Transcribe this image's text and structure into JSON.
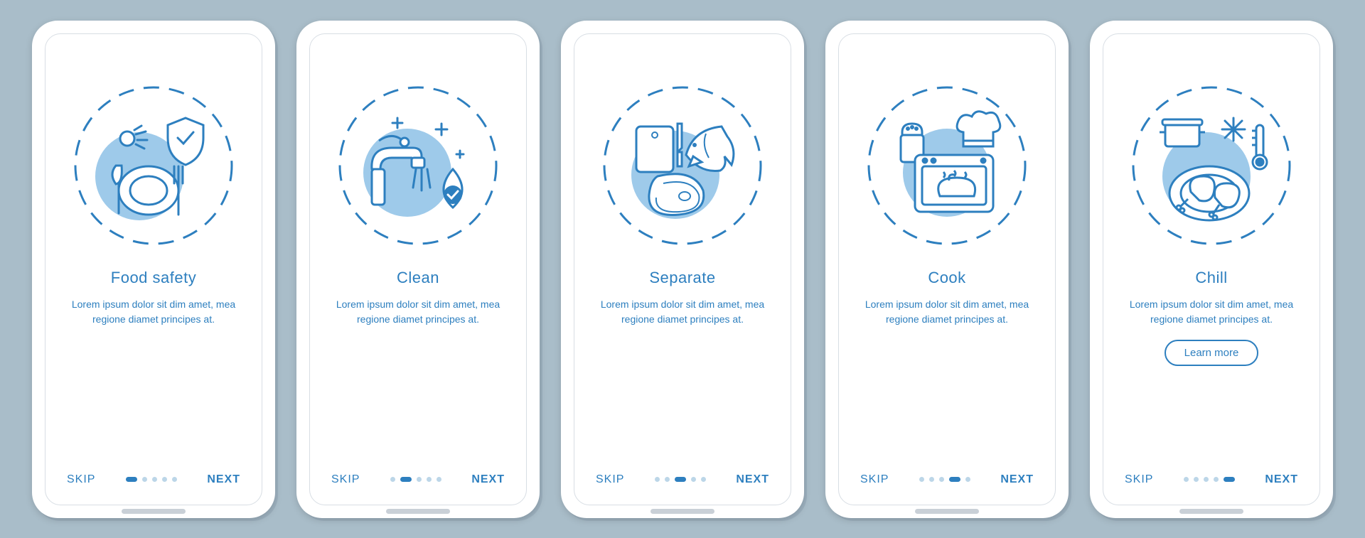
{
  "colors": {
    "primary": "#2d7fbf",
    "light": "#bcd6e8",
    "blob": "#9ecaea",
    "blob2": "#c7e1f1",
    "bg": "#a9bdc9"
  },
  "common": {
    "skip": "SKIP",
    "next": "NEXT",
    "learn_more": "Learn more",
    "desc": "Lorem ipsum dolor sit dim amet, mea regione diamet principes at."
  },
  "screens": [
    {
      "id": "food-safety",
      "title": "Food safety",
      "icon": "food-safety-icon",
      "active_dot": 0,
      "has_learn_more": false
    },
    {
      "id": "clean",
      "title": "Clean",
      "icon": "clean-icon",
      "active_dot": 1,
      "has_learn_more": false
    },
    {
      "id": "separate",
      "title": "Separate",
      "icon": "separate-icon",
      "active_dot": 2,
      "has_learn_more": false
    },
    {
      "id": "cook",
      "title": "Cook",
      "icon": "cook-icon",
      "active_dot": 3,
      "has_learn_more": false
    },
    {
      "id": "chill",
      "title": "Chill",
      "icon": "chill-icon",
      "active_dot": 4,
      "has_learn_more": true
    }
  ],
  "dot_count": 5
}
